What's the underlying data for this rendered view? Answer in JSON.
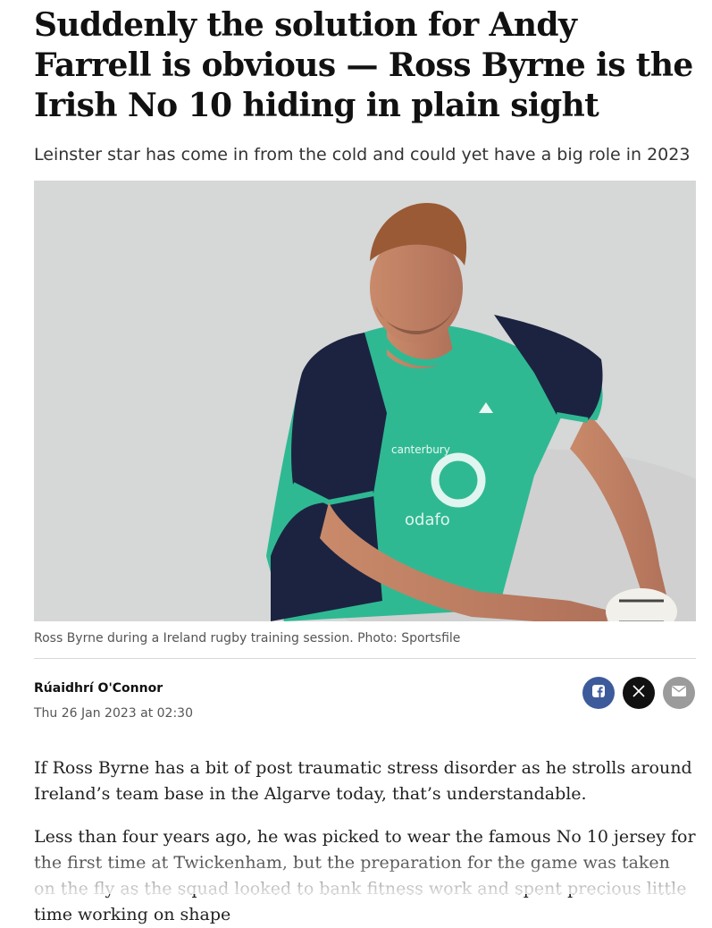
{
  "article": {
    "headline": "Suddenly the solution for Andy Farrell is obvious — Ross Byrne is the Irish No 10 hiding in plain sight",
    "standfirst": "Leinster star has come in from the cold and could yet have a big role in 2023",
    "image_caption": "Ross Byrne during a Ireland rugby training session. Photo: Sportsfile",
    "author": "Rúaidhrí O'Connor",
    "date": "Thu 26 Jan 2023 at 02:30",
    "paragraphs": [
      "If Ross Byrne has a bit of post traumatic stress disorder as he strolls around Ireland’s team base in the Algarve today, that’s understandable.",
      "Less than four years ago, he was picked to wear the famous No 10 jersey for the first time at Twickenham, but the preparation for the game was taken on the fly as the squad looked to bank fitness work and spent precious little time working on shape"
    ]
  },
  "share": {
    "icons": [
      "facebook-icon",
      "x-icon",
      "email-icon"
    ]
  },
  "colors": {
    "facebook": "#3d5b9b",
    "x": "#111111",
    "email": "#9b9b9b",
    "jersey_teal": "#2fb993",
    "jersey_navy": "#1c2340"
  }
}
